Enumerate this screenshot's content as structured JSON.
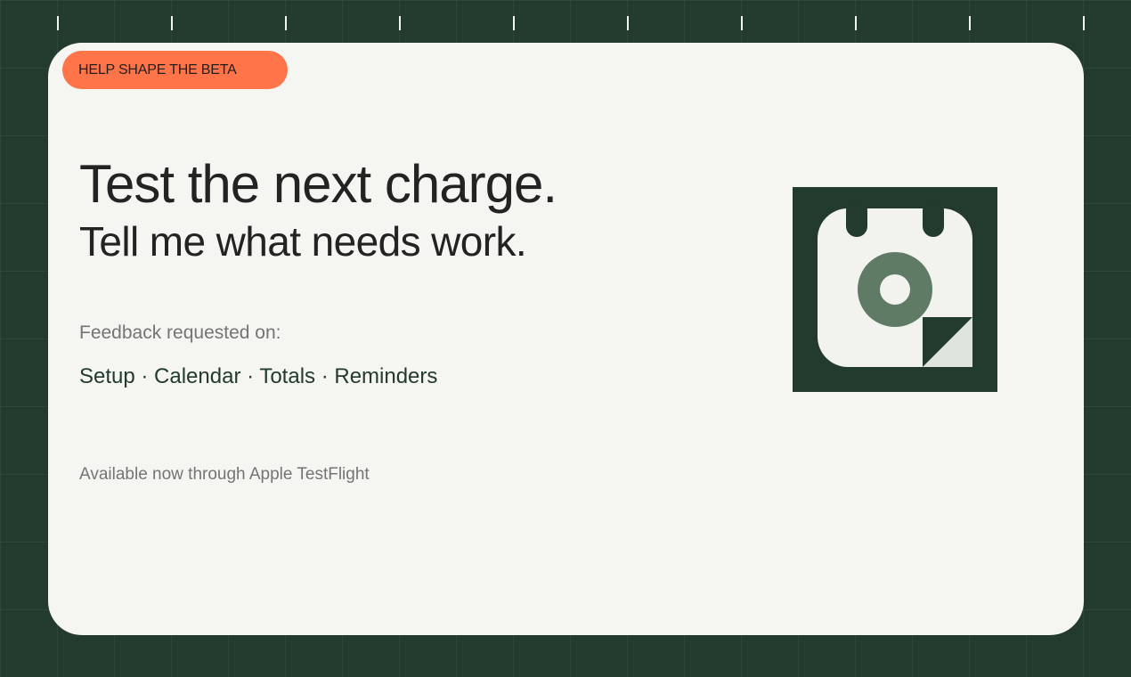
{
  "badge": {
    "label": "HELP SHAPE THE BETA"
  },
  "headline": "Test the next charge.",
  "subhead": "Tell me what needs work.",
  "feedback": {
    "label": "Feedback requested on:",
    "areas": "Setup · Calendar · Totals · Reminders"
  },
  "availability": "Available now through Apple TestFlight",
  "app_icon": {
    "name": "calendar-charge-icon"
  },
  "colors": {
    "background": "#233a2e",
    "card": "#f5f5f2",
    "accent": "#ff7448",
    "icon_ring": "#5f7a65"
  }
}
